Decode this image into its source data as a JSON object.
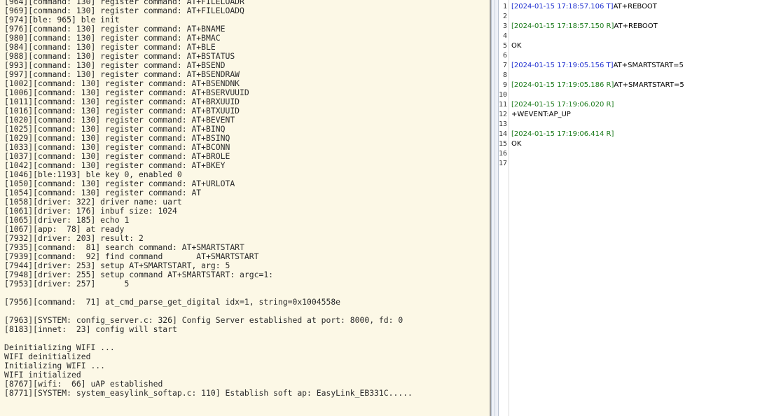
{
  "left_console": {
    "lines": [
      "[964][command: 130] register command: AT+FILELOADR",
      "[969][command: 130] register command: AT+FILELOADQ",
      "[974][ble: 965] ble init",
      "[976][command: 130] register command: AT+BNAME",
      "[980][command: 130] register command: AT+BMAC",
      "[984][command: 130] register command: AT+BLE",
      "[988][command: 130] register command: AT+BSTATUS",
      "[993][command: 130] register command: AT+BSEND",
      "[997][command: 130] register command: AT+BSENDRAW",
      "[1002][command: 130] register command: AT+BSENDNK",
      "[1006][command: 130] register command: AT+BSERVUUID",
      "[1011][command: 130] register command: AT+BRXUUID",
      "[1016][command: 130] register command: AT+BTXUUID",
      "[1020][command: 130] register command: AT+BEVENT",
      "[1025][command: 130] register command: AT+BINQ",
      "[1029][command: 130] register command: AT+BSINQ",
      "[1033][command: 130] register command: AT+BCONN",
      "[1037][command: 130] register command: AT+BROLE",
      "[1042][command: 130] register command: AT+BKEY",
      "[1046][ble:1193] ble key 0, enabled 0",
      "[1050][command: 130] register command: AT+URLOTA",
      "[1054][command: 130] register command: AT",
      "[1058][driver: 322] driver name: uart",
      "[1061][driver: 176] inbuf size: 1024",
      "[1065][driver: 185] echo 1",
      "[1067][app:  78] at ready",
      "[7932][driver: 203] result: 2",
      "[7935][command:  81] search command: AT+SMARTSTART",
      "[7939][command:  92] find command       AT+SMARTSTART",
      "[7944][driver: 253] setup AT+SMARTSTART, arg: 5",
      "[7948][driver: 255] setup command AT+SMARTSTART: argc=1:",
      "[7953][driver: 257]      5",
      "",
      "[7956][command:  71] at_cmd_parse_get_digital idx=1, string=0x1004558e",
      "",
      "[7963][SYSTEM: config_server.c: 326] Config Server established at port: 8000, fd: 0",
      "[8183][innet:  23] config will start",
      "",
      "Deinitializing WIFI ...",
      "WIFI deinitialized",
      "Initializing WIFI ...",
      "WIFI initialized",
      "[8767][wifi:  66] uAP established",
      "[8771][SYSTEM: system_easylink_softap.c: 110] Establish soft ap: EasyLink_EB331C....."
    ]
  },
  "right_log": {
    "colors": {
      "timestamp_T": "#1f2fd0",
      "timestamp_R": "#1a7a1a",
      "text": "#000000",
      "line_number": "#333333"
    },
    "lines": [
      {
        "num": "1",
        "ts": "[2024-01-15 17:18:57.106 T]",
        "kind": "T",
        "text": "AT+REBOOT"
      },
      {
        "num": "2",
        "ts": "",
        "kind": "",
        "text": ""
      },
      {
        "num": "3",
        "ts": "[2024-01-15 17:18:57.150 R]",
        "kind": "R",
        "text": "AT+REBOOT"
      },
      {
        "num": "4",
        "ts": "",
        "kind": "",
        "text": ""
      },
      {
        "num": "5",
        "ts": "",
        "kind": "",
        "text": "OK"
      },
      {
        "num": "6",
        "ts": "",
        "kind": "",
        "text": ""
      },
      {
        "num": "7",
        "ts": "[2024-01-15 17:19:05.156 T]",
        "kind": "T",
        "text": "AT+SMARTSTART=5"
      },
      {
        "num": "8",
        "ts": "",
        "kind": "",
        "text": ""
      },
      {
        "num": "9",
        "ts": "[2024-01-15 17:19:05.186 R]",
        "kind": "R",
        "text": "AT+SMARTSTART=5"
      },
      {
        "num": "10",
        "ts": "",
        "kind": "",
        "text": ""
      },
      {
        "num": "11",
        "ts": "[2024-01-15 17:19:06.020 R]",
        "kind": "R",
        "text": ""
      },
      {
        "num": "12",
        "ts": "",
        "kind": "",
        "text": "+WEVENT:AP_UP"
      },
      {
        "num": "13",
        "ts": "",
        "kind": "",
        "text": ""
      },
      {
        "num": "14",
        "ts": "[2024-01-15 17:19:06.414 R]",
        "kind": "R",
        "text": ""
      },
      {
        "num": "15",
        "ts": "",
        "kind": "",
        "text": "OK"
      },
      {
        "num": "16",
        "ts": "",
        "kind": "",
        "text": ""
      },
      {
        "num": "17",
        "ts": "",
        "kind": "",
        "text": ""
      }
    ]
  }
}
